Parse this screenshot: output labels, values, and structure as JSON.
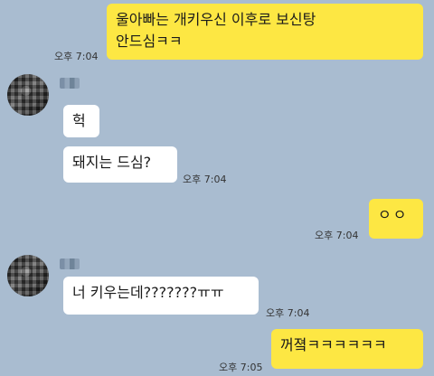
{
  "colors": {
    "background": "#a9bcd0",
    "mine_bubble": "#fde743",
    "their_bubble": "#ffffff"
  },
  "messages": [
    {
      "text": "울아빠는 개키우신 이후로 보신탕\n안드심ㅋㅋ",
      "time": "오후 7:04"
    },
    {
      "text": "헉",
      "time": ""
    },
    {
      "text": "돼지는 드심?",
      "time": "오후 7:04"
    },
    {
      "text": "ㅇㅇ",
      "time": "오후 7:04"
    },
    {
      "text": "너 키우는데???????ㅠㅠ",
      "time": "오후 7:04"
    },
    {
      "text": "꺼졐ㅋㅋㅋㅋㅋㅋ",
      "time": "오후 7:05"
    }
  ]
}
